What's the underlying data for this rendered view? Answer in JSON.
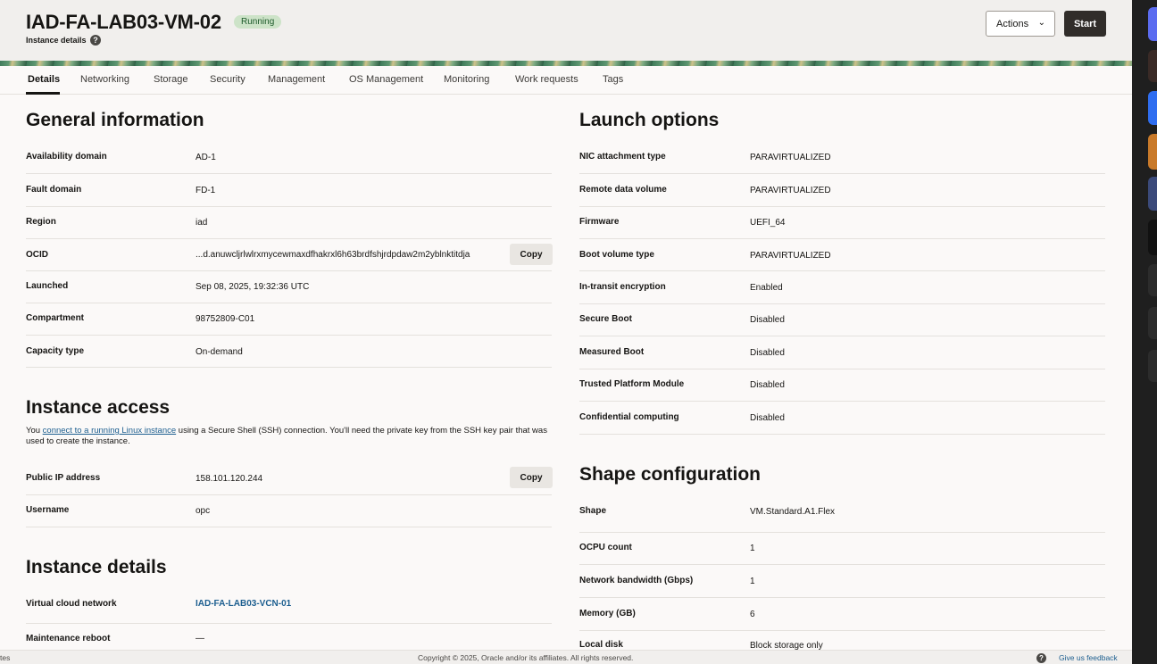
{
  "header": {
    "title": "IAD-FA-LAB03-VM-02",
    "status": "Running",
    "subtitle": "Instance details",
    "help_icon": "?",
    "actions_label": "Actions",
    "start_label": "Start"
  },
  "tabs": [
    "Details",
    "Networking",
    "Storage",
    "Security",
    "Management",
    "OS Management",
    "Monitoring",
    "Work requests",
    "Tags"
  ],
  "general": {
    "heading": "General information",
    "rows": [
      {
        "label": "Availability domain",
        "value": "AD-1"
      },
      {
        "label": "Fault domain",
        "value": "FD-1"
      },
      {
        "label": "Region",
        "value": "iad"
      },
      {
        "label": "OCID",
        "value": "...d.anuwcljrlwlrxmycewmaxdfhakrxl6h63brdfshjrdpdaw2m2yblnktitdja"
      },
      {
        "label": "Launched",
        "value": "Sep 08, 2025, 19:32:36 UTC"
      },
      {
        "label": "Compartment",
        "value": "98752809-C01"
      },
      {
        "label": "Capacity type",
        "value": "On-demand"
      }
    ],
    "copy_label": "Copy"
  },
  "access": {
    "heading": "Instance access",
    "text_before": "You ",
    "link_text": "connect to a running Linux instance",
    "text_after": " using a Secure Shell (SSH) connection. You'll need the private key from the SSH key pair that was used to create the instance.",
    "rows": [
      {
        "label": "Public IP address",
        "value": "158.101.120.244"
      },
      {
        "label": "Username",
        "value": "opc"
      }
    ],
    "copy_label": "Copy"
  },
  "details": {
    "heading": "Instance details",
    "rows": [
      {
        "label": "Virtual cloud network",
        "value": "IAD-FA-LAB03-VCN-01"
      },
      {
        "label": "Maintenance reboot",
        "value": "—"
      }
    ]
  },
  "launch": {
    "heading": "Launch options",
    "rows": [
      {
        "label": "NIC attachment type",
        "value": "PARAVIRTUALIZED"
      },
      {
        "label": "Remote data volume",
        "value": "PARAVIRTUALIZED"
      },
      {
        "label": "Firmware",
        "value": "UEFI_64"
      },
      {
        "label": "Boot volume type",
        "value": "PARAVIRTUALIZED"
      },
      {
        "label": "In-transit encryption",
        "value": "Enabled"
      },
      {
        "label": "Secure Boot",
        "value": "Disabled"
      },
      {
        "label": "Measured Boot",
        "value": "Disabled"
      },
      {
        "label": "Trusted Platform Module",
        "value": "Disabled"
      },
      {
        "label": "Confidential computing",
        "value": "Disabled"
      }
    ]
  },
  "shape": {
    "heading": "Shape configuration",
    "rows": [
      {
        "label": "Shape",
        "value": "VM.Standard.A1.Flex"
      },
      {
        "label": "OCPU count",
        "value": "1"
      },
      {
        "label": "Network bandwidth (Gbps)",
        "value": "1"
      },
      {
        "label": "Memory (GB)",
        "value": "6"
      },
      {
        "label": "Local disk",
        "value": "Block storage only"
      }
    ]
  },
  "footer": {
    "left": "tes",
    "copyright": "Copyright © 2025, Oracle and/or its affiliates. All rights reserved.",
    "help_icon": "?",
    "feedback": "Give us feedback"
  },
  "colors": {
    "header_bg": "#f1efed",
    "status_badge_bg": "#cde3c8",
    "link": "#1c5e8f",
    "primary_button": "#312d2a"
  }
}
